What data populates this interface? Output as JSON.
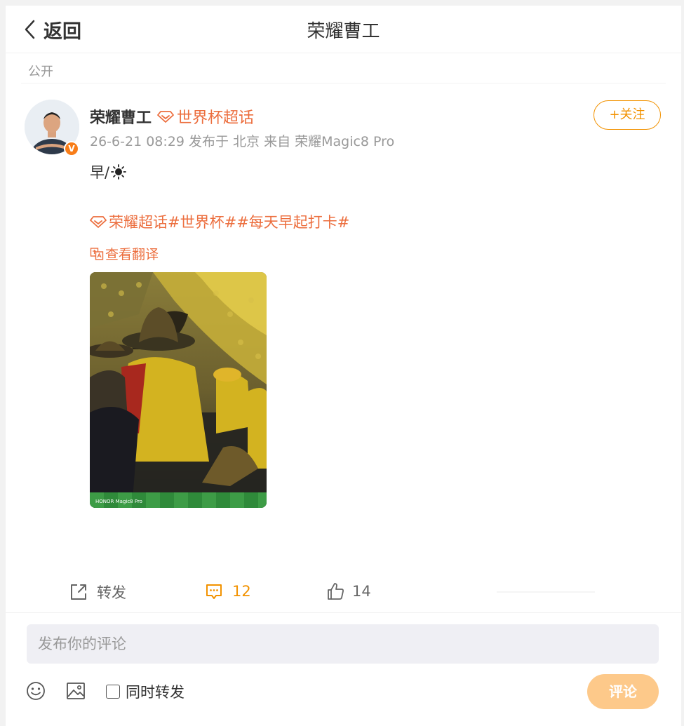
{
  "header": {
    "back_label": "返回",
    "title": "荣耀曹工"
  },
  "visibility": "公开",
  "post": {
    "author": "荣耀曹工",
    "verified_badge": "V",
    "topic_tag": "世界杯超话",
    "meta": "26-6-21 08:29 发布于 北京 来自 荣耀Magic8 Pro",
    "text": "早/",
    "hashtags": "荣耀超话#世界杯##每天早起打卡#",
    "translate_label": "查看翻译",
    "photo_watermark": "HONOR Magic8 Pro",
    "follow_label": "+关注"
  },
  "actions": {
    "repost_label": "转发",
    "comment_count": "12",
    "like_count": "14"
  },
  "comment_box": {
    "placeholder": "发布你的评论",
    "also_repost_label": "同时转发",
    "submit_label": "评论"
  },
  "colors": {
    "accent_orange": "#f29200",
    "link_orange": "#ec6e3e",
    "submit_disabled": "#fdc98a"
  },
  "icons": [
    "chevron-left-icon",
    "diamond-icon",
    "sun-icon",
    "translate-icon",
    "repost-icon",
    "comment-icon",
    "like-icon",
    "emoji-icon",
    "image-icon"
  ]
}
